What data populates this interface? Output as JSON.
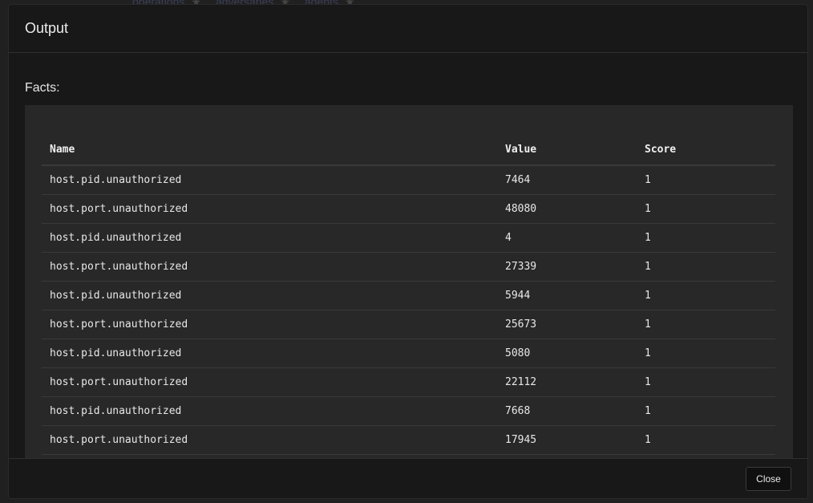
{
  "background": {
    "tabs": [
      "operations",
      "adversaries",
      "agents"
    ]
  },
  "modal": {
    "title": "Output",
    "facts_label": "Facts:",
    "table": {
      "headers": [
        "Name",
        "Value",
        "Score"
      ],
      "rows": [
        {
          "name": "host.pid.unauthorized",
          "value": "7464",
          "score": "1"
        },
        {
          "name": "host.port.unauthorized",
          "value": "48080",
          "score": "1"
        },
        {
          "name": "host.pid.unauthorized",
          "value": "4",
          "score": "1"
        },
        {
          "name": "host.port.unauthorized",
          "value": "27339",
          "score": "1"
        },
        {
          "name": "host.pid.unauthorized",
          "value": "5944",
          "score": "1"
        },
        {
          "name": "host.port.unauthorized",
          "value": "25673",
          "score": "1"
        },
        {
          "name": "host.pid.unauthorized",
          "value": "5080",
          "score": "1"
        },
        {
          "name": "host.port.unauthorized",
          "value": "22112",
          "score": "1"
        },
        {
          "name": "host.pid.unauthorized",
          "value": "7668",
          "score": "1"
        },
        {
          "name": "host.port.unauthorized",
          "value": "17945",
          "score": "1"
        }
      ]
    },
    "close_label": "Close"
  },
  "colors": {
    "modal_background": "#181818",
    "panel_background": "#282828",
    "text": "#e8e8e8"
  }
}
